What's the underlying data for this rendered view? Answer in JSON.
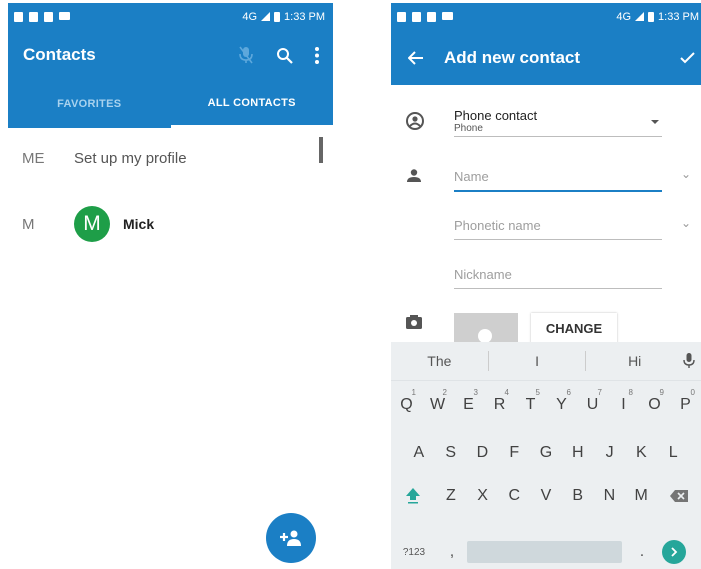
{
  "status": {
    "network": "4G",
    "time": "1:33 PM"
  },
  "contacts_screen": {
    "title": "Contacts",
    "tabs": [
      "FAVORITES",
      "ALL CONTACTS"
    ],
    "rows": [
      {
        "letter": "ME",
        "text": "Set up my profile"
      },
      {
        "letter": "M",
        "avatar_letter": "M",
        "name": "Mick"
      }
    ],
    "avatar_color": "#1e9e48",
    "accent": "#1b7fc5"
  },
  "add_screen": {
    "title": "Add new contact",
    "account": {
      "label": "Phone contact",
      "sub": "Phone"
    },
    "name_placeholder": "Name",
    "phonetic_placeholder": "Phonetic name",
    "nickname_placeholder": "Nickname",
    "change_label": "CHANGE"
  },
  "keyboard": {
    "suggestions": [
      "The",
      "I",
      "Hi"
    ],
    "row1": [
      {
        "k": "Q",
        "n": "1"
      },
      {
        "k": "W",
        "n": "2"
      },
      {
        "k": "E",
        "n": "3"
      },
      {
        "k": "R",
        "n": "4"
      },
      {
        "k": "T",
        "n": "5"
      },
      {
        "k": "Y",
        "n": "6"
      },
      {
        "k": "U",
        "n": "7"
      },
      {
        "k": "I",
        "n": "8"
      },
      {
        "k": "O",
        "n": "9"
      },
      {
        "k": "P",
        "n": "0"
      }
    ],
    "row2": [
      "A",
      "S",
      "D",
      "F",
      "G",
      "H",
      "J",
      "K",
      "L"
    ],
    "row3": [
      "Z",
      "X",
      "C",
      "V",
      "B",
      "N",
      "M"
    ],
    "symbols_label": "?123",
    "comma": ",",
    "period": "."
  }
}
